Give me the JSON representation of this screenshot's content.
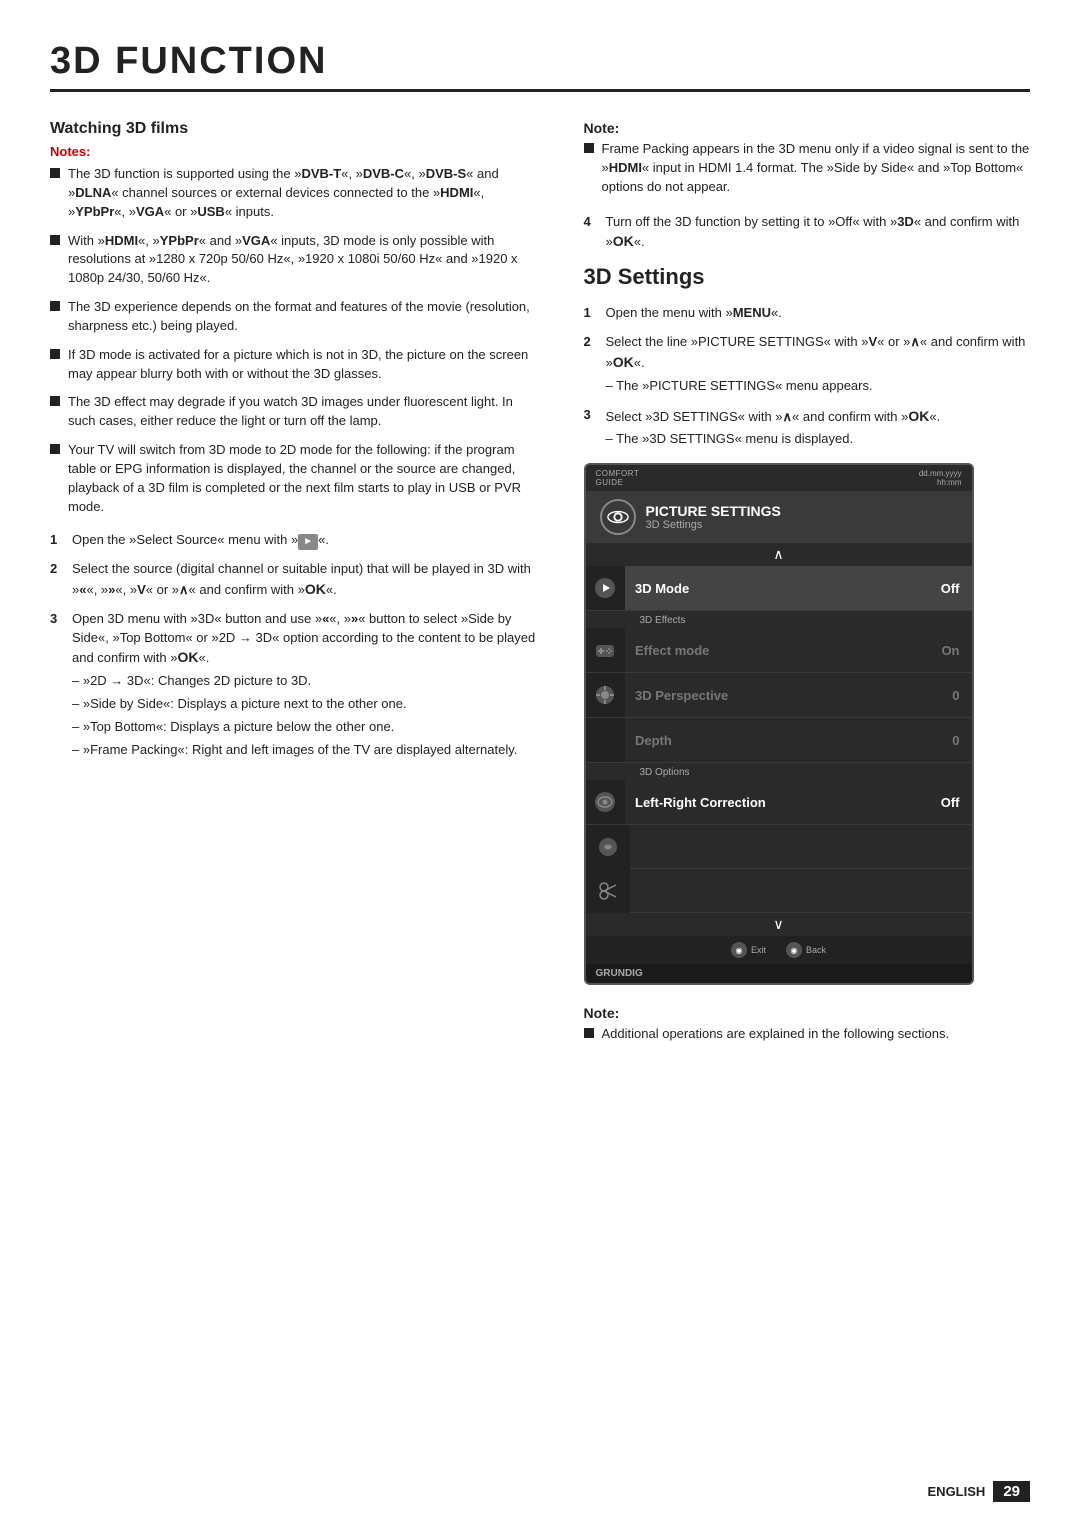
{
  "page": {
    "title": "3D FUNCTION",
    "footer": {
      "lang": "ENGLISH",
      "page_num": "29"
    }
  },
  "left_col": {
    "section_title": "Watching 3D films",
    "notes_label": "Notes:",
    "bullets": [
      "The 3D function is supported using the »DVB-T«, »DVB-C«, »DVB-S« and »DLNA« channel sources or external devices connected to the »HDMI«, »YPbPr«, »VGA« or »USB« inputs.",
      "With »HDMI«, »YPbPr« and »VGA« inputs, 3D mode is only possible with resolutions at »1280 x 720p 50/60 Hz«, »1920 x 1080i 50/60 Hz« and »1920 x 1080p 24/30, 50/60 Hz«.",
      "The 3D experience depends on the format and features of the movie (resolution, sharpness etc.) being played.",
      "If 3D mode is activated for a picture which is not in 3D, the picture on the screen may appear blurry both with or without the 3D glasses.",
      "The 3D effect may degrade if you watch 3D images under fluorescent light. In such cases, either reduce the light or turn off the lamp.",
      "Your TV will switch from 3D mode to 2D mode for the following: if the program table or EPG information is displayed, the channel or the source are changed, playback of a 3D film is completed or the next film starts to play in USB or PVR mode."
    ],
    "steps": [
      {
        "num": "1",
        "text": "Open the »Select Source« menu with »",
        "suffix": "«."
      },
      {
        "num": "2",
        "text": "Select the source (digital channel or suitable input) that will be played in 3D with »",
        "suffix": "«, »»«, »V« or »∧« and confirm with »OK«."
      },
      {
        "num": "3",
        "text": "Open 3D menu with »3D« button and use »«, »»« button to select »Side by Side«, »Top Bottom« or »2D → 3D« option according to the content to be played and confirm with »OK«.",
        "sub_items": [
          "– »2D → 3D«: Changes 2D picture to 3D.",
          "– »Side by Side«: Displays a picture next to the other one.",
          "– »Top Bottom«: Displays a picture below the other one.",
          "– »Frame Packing«: Right and left images of the TV are displayed alternately."
        ]
      }
    ]
  },
  "right_col": {
    "note_top": {
      "label": "Note:",
      "bullets": [
        "Frame Packing appears in the 3D menu only if a video signal is sent to the »HDMI« input in HDMI 1.4 format. The »Side by Side« and »Top Bottom« options do not appear."
      ]
    },
    "step4": {
      "num": "4",
      "text": "Turn off the 3D function by setting it to »Off« with »3D« and confirm with »OK«."
    },
    "settings_title": "3D Settings",
    "settings_steps": [
      {
        "num": "1",
        "text": "Open the menu with »MENU«."
      },
      {
        "num": "2",
        "text": "Select the line »PICTURE SETTINGS« with »V« or »∧« and confirm with »OK«.",
        "sub": "– The »PICTURE SETTINGS« menu appears."
      },
      {
        "num": "3",
        "text": "Select »3D SETTINGS« with »∧« and confirm with »OK«.",
        "sub": "– The »3D SETTINGS« menu is displayed."
      }
    ],
    "tv_menu": {
      "top_bar_left": "COMFORT GUIDE",
      "top_bar_right": "dd.mm.yyyy hh:mm",
      "menu_title": "PICTURE SETTINGS",
      "menu_subtitle": "3D Settings",
      "rows": [
        {
          "type": "main",
          "label": "3D Mode",
          "value": "Off",
          "active": true,
          "section_before": null
        },
        {
          "type": "section",
          "section_label": "3D Effects"
        },
        {
          "type": "main",
          "label": "Effect mode",
          "value": "On",
          "active": false,
          "dimmed": true
        },
        {
          "type": "main",
          "label": "3D Perspective",
          "value": "0",
          "active": false,
          "dimmed": true
        },
        {
          "type": "main",
          "label": "Depth",
          "value": "0",
          "active": false,
          "dimmed": true
        },
        {
          "type": "section",
          "section_label": "3D Options"
        },
        {
          "type": "main",
          "label": "Left-Right Correction",
          "value": "Off",
          "active": false,
          "dimmed": false
        }
      ],
      "bottom_buttons": [
        {
          "icon": "◉",
          "label": "Exit"
        },
        {
          "icon": "◉",
          "label": "Back"
        }
      ]
    },
    "note_bottom": {
      "label": "Note:",
      "bullets": [
        "Additional operations are explained in the following sections."
      ]
    }
  }
}
